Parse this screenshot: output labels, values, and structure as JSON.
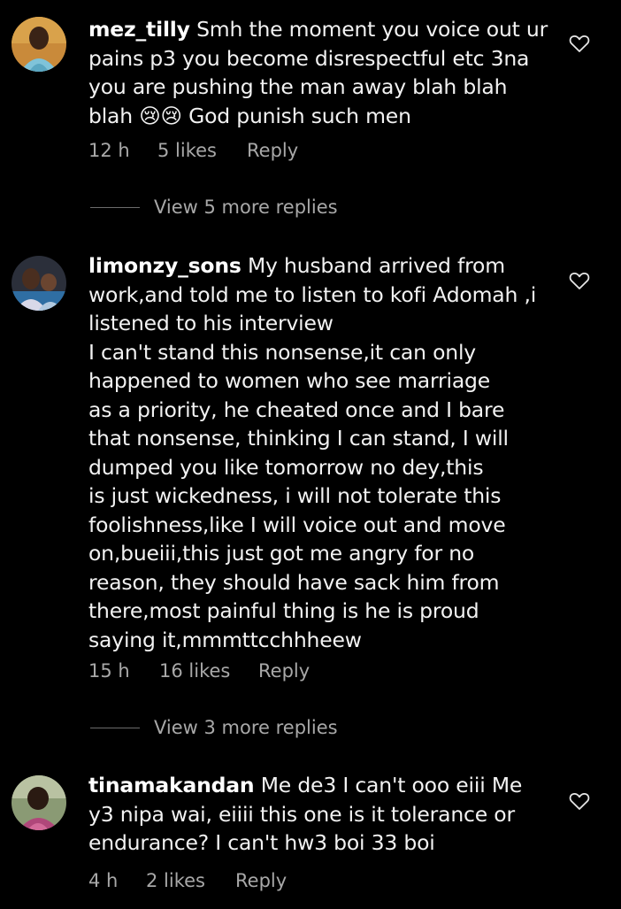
{
  "comments": [
    {
      "username": "mez_tilly",
      "text": "Smh the moment you voice out ur\npains p3 you become disrespectful etc 3na\nyou are pushing the man away blah blah\nblah 😢😢 God punish such men",
      "time": "12 h",
      "likes": "5 likes",
      "reply": "Reply",
      "view_replies": "View 5 more replies",
      "heart_icon": "heart-outline-icon"
    },
    {
      "username": "limonzy_sons",
      "text": "My husband arrived from\nwork,and told me to listen to kofi Adomah ,i\nlistened to his interview\nI can't stand this nonsense,it  can only\nhappened to women who see marriage\nas a priority, he cheated once and I bare\nthat nonsense, thinking I can stand, I will\ndumped  you like tomorrow no dey,this\nis just wickedness, i will not tolerate this\nfoolishness,like I will voice out and move\non,bueiii,this just got me angry for no\nreason, they should have sack him from\nthere,most painful thing is he is proud\nsaying it,mmmttcchhheew",
      "time": "15 h",
      "likes": "16 likes",
      "reply": "Reply",
      "view_replies": "View 3 more replies",
      "heart_icon": "heart-outline-icon"
    },
    {
      "username": "tinamakandan",
      "text": "Me de3 I can't ooo eiii Me\ny3 nipa wai, eiiii this one is it tolerance or\nendurance? I can't hw3 boi 33 boi",
      "time": "4 h",
      "likes": "2 likes",
      "reply": "Reply",
      "heart_icon": "heart-outline-icon"
    }
  ],
  "colors": {
    "background": "#000000",
    "text": "#f2f2f2",
    "muted": "#a8a8a8"
  }
}
